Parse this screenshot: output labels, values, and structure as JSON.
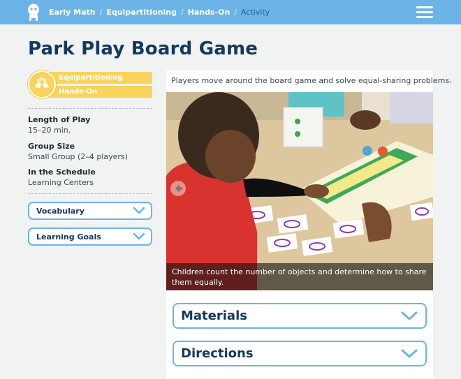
{
  "breadcrumb": {
    "items": [
      "Early Math",
      "Equipartitioning",
      "Hands-On"
    ],
    "current": "Activity"
  },
  "page": {
    "title": "Park Play Board Game"
  },
  "badge": {
    "line1": "Equipartitioning",
    "line2": "Hands-On"
  },
  "details": {
    "length_label": "Length of Play",
    "length_value": "15–20 min.",
    "group_label": "Group Size",
    "group_value": "Small Group (2–4 players)",
    "schedule_label": "In the Schedule",
    "schedule_value": "Learning Centers"
  },
  "sidebar_accordions": {
    "vocabulary": "Vocabulary",
    "goals": "Learning Goals"
  },
  "main": {
    "intro": "Players move around the board game and solve equal-sharing problems.",
    "caption": "Children count the number of objects and determine how to share them equally.",
    "materials": "Materials",
    "directions": "Directions"
  },
  "colors": {
    "topbar": "#6cb4e8",
    "title": "#13395f",
    "badge": "#f8d45c",
    "accordion_border": "#6cb4e8"
  },
  "icons": [
    "logo-icon",
    "menu-icon",
    "hands-icon",
    "chevron-down-icon",
    "arrow-left-icon"
  ]
}
